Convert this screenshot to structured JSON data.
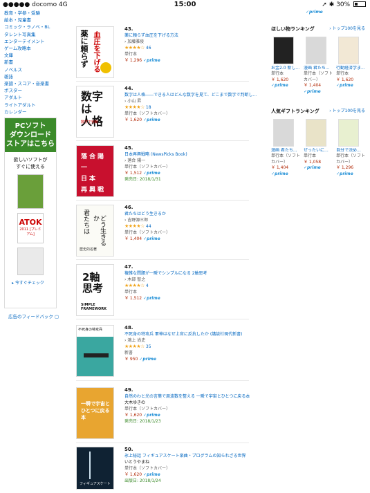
{
  "status": {
    "carrier": "●●●●● docomo  4G",
    "time": "15:00",
    "battery": "30%"
  },
  "leftnav": {
    "items": [
      "教育・学参・受験",
      "絵本・児童書",
      "コミック・ラノベ・BL",
      "タレント写真集",
      "エンターテイメント",
      "ゲーム攻略本",
      "文庫",
      "新書",
      "ノベルス",
      "雑誌",
      "楽譜・スコア・音楽書",
      "ポスター",
      "アダルト",
      "ライトアダルト",
      "カレンダー"
    ]
  },
  "promo": {
    "banner": "PCソフト\nダウンロード\nストアはこちら",
    "subtitle": "欲しいソフトが\nすぐに使える",
    "atok_name": "ATOK",
    "atok_detail": "2011 [プレミアム]",
    "check_label": "▸ 今すぐチェック",
    "feedback_label": "広告のフィードバック"
  },
  "list": [
    {
      "rank": "43.",
      "title": "薬に頼らず血圧を下げる方法",
      "author": "› 加藤雅俊",
      "format": "単行本",
      "stars": "★★★★☆",
      "reviews": "46",
      "price": "￥ 1,296",
      "prime": "✓prime",
      "date": ""
    },
    {
      "rank": "44.",
      "title": "数字は人格――できる人はどんな数字を見て、どこまで数字で判断し...",
      "author": "› 小山 昇",
      "format": "単行本（ソフトカバー）",
      "stars": "★★★★☆",
      "reviews": "18",
      "price": "￥ 1,620",
      "prime": "✓prime",
      "date": ""
    },
    {
      "rank": "45.",
      "title": "日本再興戦略 (NewsPicks Book)",
      "author": "› 落合 陽一",
      "format": "単行本（ソフトカバー）",
      "stars": "",
      "reviews": "",
      "price": "￥ 1,512",
      "prime": "✓prime",
      "date": "発売日: 2018/1/31"
    },
    {
      "rank": "46.",
      "title": "君たちはどう生きるか",
      "author": "› 吉野源三郎",
      "format": "単行本（ソフトカバー）",
      "stars": "★★★★☆",
      "reviews": "44",
      "price": "￥ 1,404",
      "prime": "✓prime",
      "date": ""
    },
    {
      "rank": "47.",
      "title": "複雑な問題が一瞬でシンプルになる 2軸思考",
      "author": "› 木部 智之",
      "format": "単行本",
      "stars": "★★★★☆",
      "reviews": "4",
      "price": "￥ 1,512",
      "prime": "✓prime",
      "date": ""
    },
    {
      "rank": "48.",
      "title": "不死身の特攻兵 軍神はなぜ上官に反抗したか (講談社現代新書)",
      "author": "› 鴻上 尚史",
      "format": "新書",
      "stars": "★★★★☆",
      "reviews": "35",
      "price": "￥ 950",
      "prime": "✓prime",
      "date": ""
    },
    {
      "rank": "49.",
      "title": "自然のわと光の言葉で周波数を整える 一瞬で宇宙とひとつに戻る本",
      "author": "大木ゆきの",
      "format": "単行本（ソフトカバー）",
      "stars": "",
      "reviews": "",
      "price": "￥ 1,620",
      "prime": "✓prime",
      "date": "発売日: 2018/1/23"
    },
    {
      "rank": "50.",
      "title": "氷上秘話 フィギュアスケート楽曲・プログラムの知られざる世界",
      "author": "いとうやまね",
      "format": "単行本（ソフトカバー）",
      "stars": "",
      "reviews": "",
      "price": "￥ 1,620",
      "prime": "✓prime",
      "date": "出版日: 2018/1/24"
    }
  ],
  "right": {
    "top_prime": "✓prime",
    "wanted": {
      "heading": "ほしい物ランキング",
      "more": "› トップ100を見る",
      "books": [
        {
          "title": "お金2.0 新し...",
          "format": "単行本",
          "price": "￥ 1,620",
          "prime": "✓prime"
        },
        {
          "title": "漫画 君たち...",
          "format": "単行本（ソフトカバー）",
          "price": "￥ 1,404",
          "prime": "✓prime"
        },
        {
          "title": "行動経済学ま...",
          "format": "単行本",
          "price": "￥ 1,620",
          "prime": "✓prime"
        }
      ]
    },
    "gift": {
      "heading": "人気ギフトランキング",
      "more": "› トップ100を見る",
      "books": [
        {
          "title": "漫画 君たち...",
          "format": "単行本（ソフトカバー）",
          "price": "￥ 1,404",
          "prime": "✓prime"
        },
        {
          "title": "ぜったいに...",
          "format": "単行本",
          "price": "￥ 1,058",
          "prime": "✓prime"
        },
        {
          "title": "自分で決め...",
          "format": "単行本（ソフトカバー）",
          "price": "￥ 1,296",
          "prime": "✓prime"
        }
      ]
    }
  },
  "colors": {
    "link": "#0066c0",
    "price": "#b12704",
    "star": "#f0a41a",
    "prime": "#1d8ed6",
    "promo": "#3b8a2a"
  }
}
